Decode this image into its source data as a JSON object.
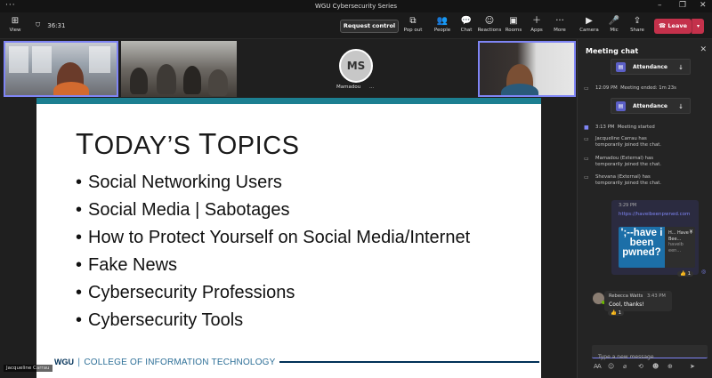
{
  "window": {
    "title": "WGU Cybersecurity Series"
  },
  "toolbar": {
    "view_label": "View",
    "timer": "36:31",
    "request_control": "Request control",
    "popout_label": "Pop out",
    "people_label": "People",
    "chat_label": "Chat",
    "reactions_label": "Reactions",
    "rooms_label": "Rooms",
    "apps_label": "Apps",
    "more_label": "More",
    "camera_label": "Camera",
    "mic_label": "Mic",
    "share_label": "Share",
    "leave_label": "Leave"
  },
  "participants": {
    "avatar_initials": "MS",
    "avatar_name": "Mamadou",
    "avatar_suffix": "...",
    "presenter_name": "Jacqueline Carrau"
  },
  "slide": {
    "title_first_cap": "T",
    "title_first_rest": "ODAY’S ",
    "title_second_cap": "T",
    "title_second_rest": "OPICS",
    "bullets": [
      "Social Networking Users",
      "Social Media | Sabotages",
      "How to Protect Yourself on Social Media/Internet",
      "Fake News",
      "Cybersecurity Professions",
      "Cybersecurity Tools"
    ],
    "footer_logo": "WGU",
    "footer_sep": "|",
    "footer_college": "COLLEGE OF INFORMATION TECHNOLOGY"
  },
  "chat": {
    "header": "Meeting chat",
    "attendance_top": "Attendance",
    "ended_time": "12:09 PM",
    "ended_text": "Meeting ended: 1m 23s",
    "attendance_bottom": "Attendance",
    "events": [
      {
        "time": "3:13 PM",
        "text": "Meeting started"
      },
      {
        "text": "Jacqueline Carrau has temporarily joined the chat."
      },
      {
        "text": "Mamadou          (External) has temporarily joined the chat."
      },
      {
        "text": "Shevana          (External) has temporarily joined the chat."
      }
    ],
    "out_msg": {
      "time": "3:29 PM",
      "link": "https://haveibeenpwned.com",
      "preview_img": "';--have i been pwned?",
      "preview_title": "H... Have I Bee...",
      "preview_domain": "haveib een...",
      "reaction": "👍 1"
    },
    "in_msg": {
      "sender": "Rebecca Watts",
      "time": "3:43 PM",
      "text": "Cool, thanks!",
      "reaction": "👍 1"
    },
    "compose_placeholder": "Type a new message"
  }
}
